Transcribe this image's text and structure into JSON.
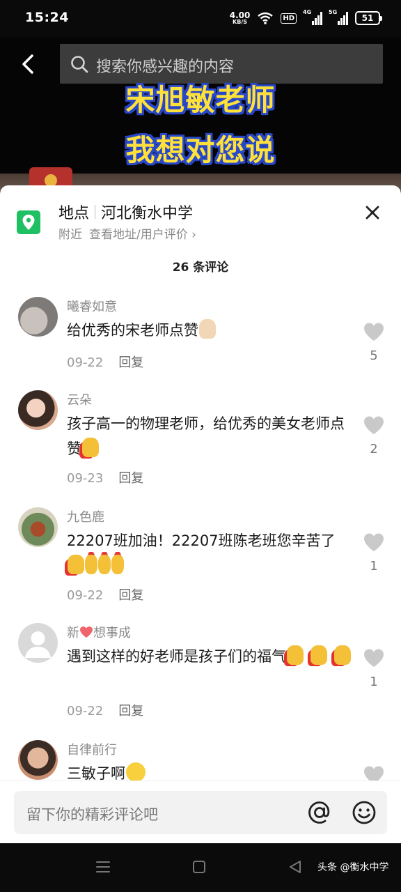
{
  "status_bar": {
    "time": "15:24",
    "net_speed_value": "4.00",
    "net_speed_unit": "KB/S",
    "hd_label": "HD",
    "sim1_label": "4G",
    "sim2_label": "5G",
    "battery": "51"
  },
  "header": {
    "search_placeholder": "搜索你感兴趣的内容",
    "overlay_line1": "宋旭敏老师",
    "overlay_line2": "我想对您说"
  },
  "location": {
    "label": "地点",
    "name": "河北衡水中学",
    "nearby": "附近",
    "view_address": "查看地址/用户评价 ›"
  },
  "comment_count": "26 条评论",
  "comments": [
    {
      "user": "曦睿如意",
      "text": "给优秀的宋老师点赞",
      "date": "09-22",
      "reply": "回复",
      "likes": "5"
    },
    {
      "user": "云朵",
      "text": "孩子高一的物理老师，给优秀的美女老师点赞",
      "date": "09-23",
      "reply": "回复",
      "likes": "2"
    },
    {
      "user": "九色鹿",
      "text": "22207班加油！22207班陈老班您辛苦了",
      "date": "09-22",
      "reply": "回复",
      "likes": "1"
    },
    {
      "user_prefix": "新",
      "user_suffix": "想事成",
      "text": "遇到这样的好老师是孩子们的福气",
      "date": "09-22",
      "reply": "回复",
      "likes": "1"
    },
    {
      "user": "自律前行",
      "text": "三敏子啊"
    }
  ],
  "input": {
    "placeholder": "留下你的精彩评论吧"
  },
  "watermark": "头条 @衡水中学",
  "icons": {
    "back": "chevron-left-icon",
    "search": "search-icon",
    "location": "location-pin-icon",
    "close": "close-icon",
    "like": "heart-icon",
    "mention": "at-icon",
    "emoji": "smile-icon"
  },
  "colors": {
    "accent_green": "#1fbf63",
    "overlay_yellow": "#ffe13a",
    "overlay_blue": "#2848c9"
  }
}
